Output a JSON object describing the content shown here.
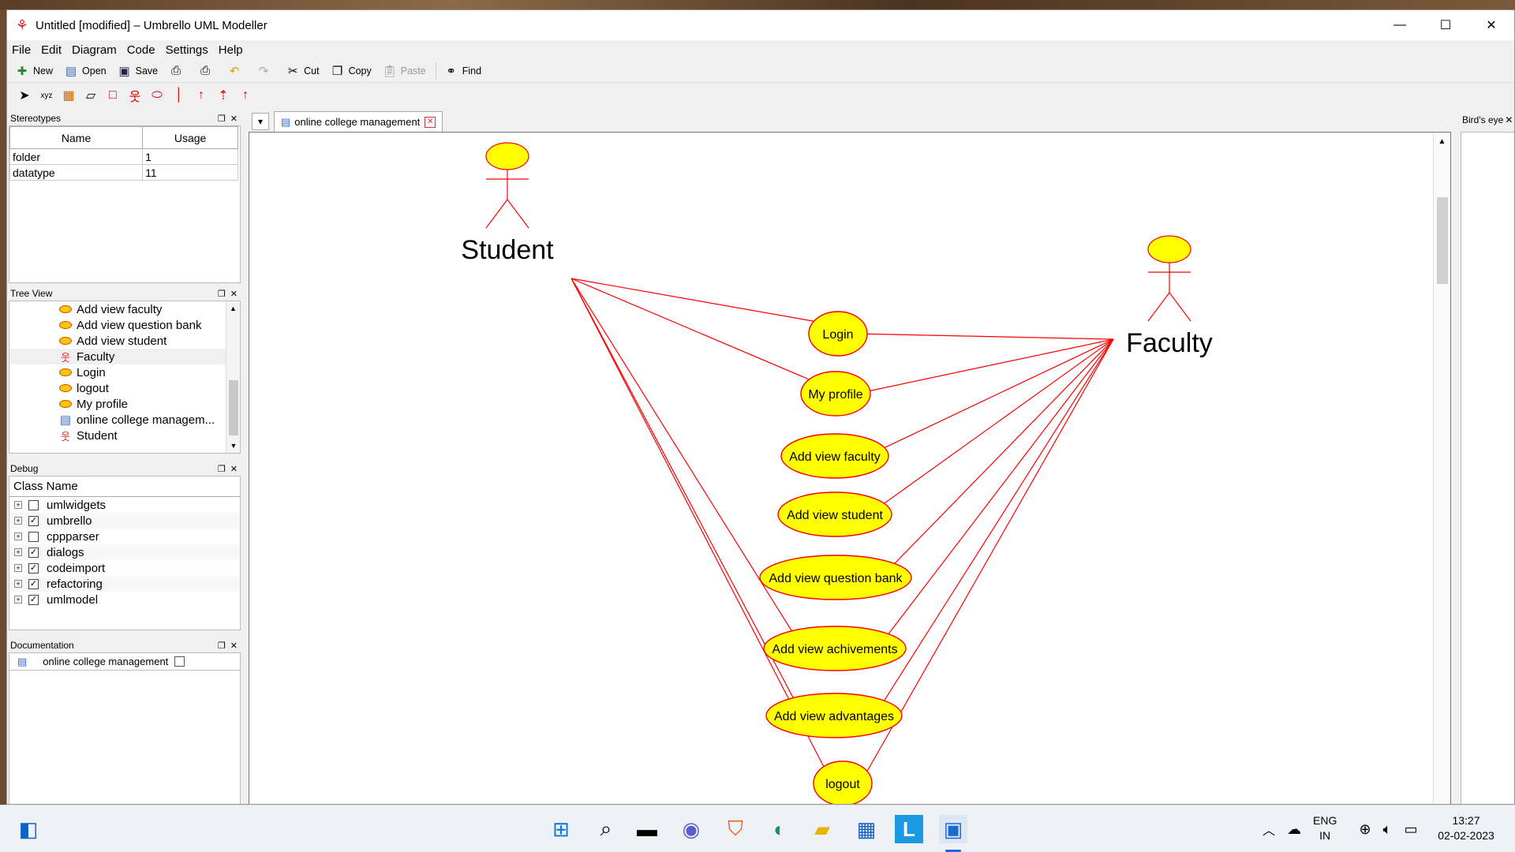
{
  "window": {
    "title": "Untitled [modified] – Umbrello UML Modeller",
    "controls": {
      "minimize": "—",
      "maximize": "☐",
      "close": "✕"
    }
  },
  "menu": [
    "File",
    "Edit",
    "Diagram",
    "Code",
    "Settings",
    "Help"
  ],
  "toolbar": {
    "new": "New",
    "open": "Open",
    "save": "Save",
    "cut": "Cut",
    "copy": "Copy",
    "paste": "Paste",
    "find": "Find"
  },
  "stereotypes": {
    "title": "Stereotypes",
    "columns": [
      "Name",
      "Usage"
    ],
    "rows": [
      {
        "name": "folder",
        "usage": "1"
      },
      {
        "name": "datatype",
        "usage": "11"
      }
    ]
  },
  "tree_view": {
    "title": "Tree View",
    "items": [
      {
        "label": "Add view faculty",
        "icon": "usecase-icon"
      },
      {
        "label": "Add view question bank",
        "icon": "usecase-icon"
      },
      {
        "label": "Add view student",
        "icon": "usecase-icon"
      },
      {
        "label": "Faculty",
        "icon": "actor-icon"
      },
      {
        "label": "Login",
        "icon": "usecase-icon"
      },
      {
        "label": "logout",
        "icon": "usecase-icon"
      },
      {
        "label": "My profile",
        "icon": "usecase-icon"
      },
      {
        "label": "online college managem...",
        "icon": "diagram-icon"
      },
      {
        "label": "Student",
        "icon": "actor-icon"
      }
    ]
  },
  "debug": {
    "title": "Debug",
    "column": "Class Name",
    "rows": [
      {
        "label": "umlwidgets",
        "checked": false
      },
      {
        "label": "umbrello",
        "checked": true
      },
      {
        "label": "cppparser",
        "checked": false
      },
      {
        "label": "dialogs",
        "checked": true
      },
      {
        "label": "codeimport",
        "checked": true
      },
      {
        "label": "refactoring",
        "checked": true
      },
      {
        "label": "umlmodel",
        "checked": true
      }
    ]
  },
  "documentation": {
    "title": "Documentation",
    "item": "online college management"
  },
  "tabs": {
    "active": "online college management"
  },
  "birds_eye": {
    "title": "Bird's eye"
  },
  "diagram": {
    "actors": [
      {
        "id": "student",
        "label": "Student"
      },
      {
        "id": "faculty",
        "label": "Faculty"
      }
    ],
    "use_cases": [
      {
        "id": "login",
        "label": "Login"
      },
      {
        "id": "myprofile",
        "label": "My profile"
      },
      {
        "id": "addfaculty",
        "label": "Add view faculty"
      },
      {
        "id": "addstudent",
        "label": "Add view student"
      },
      {
        "id": "addqbank",
        "label": "Add view question bank"
      },
      {
        "id": "addachieve",
        "label": "Add view achivements"
      },
      {
        "id": "addadvant",
        "label": "Add view advantages"
      },
      {
        "id": "logout",
        "label": "logout"
      }
    ],
    "associations": [
      [
        "student",
        "login"
      ],
      [
        "student",
        "myprofile"
      ],
      [
        "student",
        "addachieve"
      ],
      [
        "student",
        "addadvant"
      ],
      [
        "student",
        "logout"
      ],
      [
        "faculty",
        "login"
      ],
      [
        "faculty",
        "myprofile"
      ],
      [
        "faculty",
        "addfaculty"
      ],
      [
        "faculty",
        "addstudent"
      ],
      [
        "faculty",
        "addqbank"
      ],
      [
        "faculty",
        "addachieve"
      ],
      [
        "faculty",
        "addadvant"
      ],
      [
        "faculty",
        "logout"
      ]
    ],
    "colors": {
      "fill": "#ffff00",
      "line": "#ff0000"
    }
  },
  "tray": {
    "lang": "ENG",
    "region": "IN",
    "time": "13:27",
    "date": "02-02-2023"
  }
}
